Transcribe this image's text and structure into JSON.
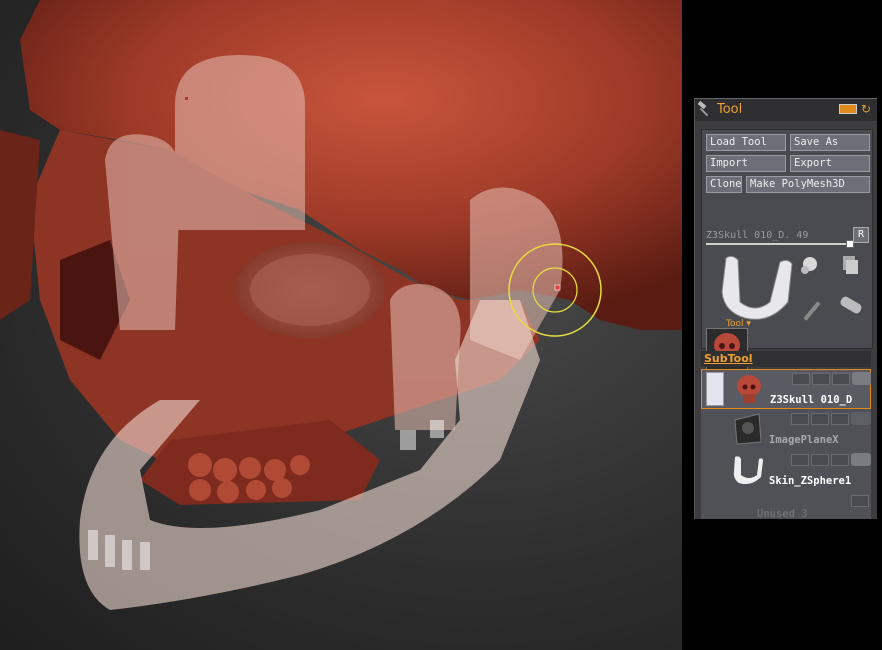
{
  "viewport": {
    "description_icon": "skull-3d-model"
  },
  "tool_panel": {
    "title": "Tool",
    "buttons": {
      "load_tool": "Load Tool",
      "save_as": "Save As",
      "import": "Import",
      "export": "Export",
      "clone": "Clone",
      "make_polymesh": "Make PolyMesh3D"
    },
    "slider_label": "Z3Skull 010_D. 49",
    "r_button": "R",
    "tool_label": "Tool",
    "subtool": {
      "title": "SubTool",
      "items": [
        {
          "name": "Z3Skull 010_D"
        },
        {
          "name": "ImagePlaneX"
        },
        {
          "name": "Skin_ZSphere1"
        },
        {
          "name": "Unused 3"
        }
      ]
    }
  },
  "colors": {
    "accent": "#f0a030",
    "panel": "#3d3d3f",
    "skull": "#a8402c"
  }
}
